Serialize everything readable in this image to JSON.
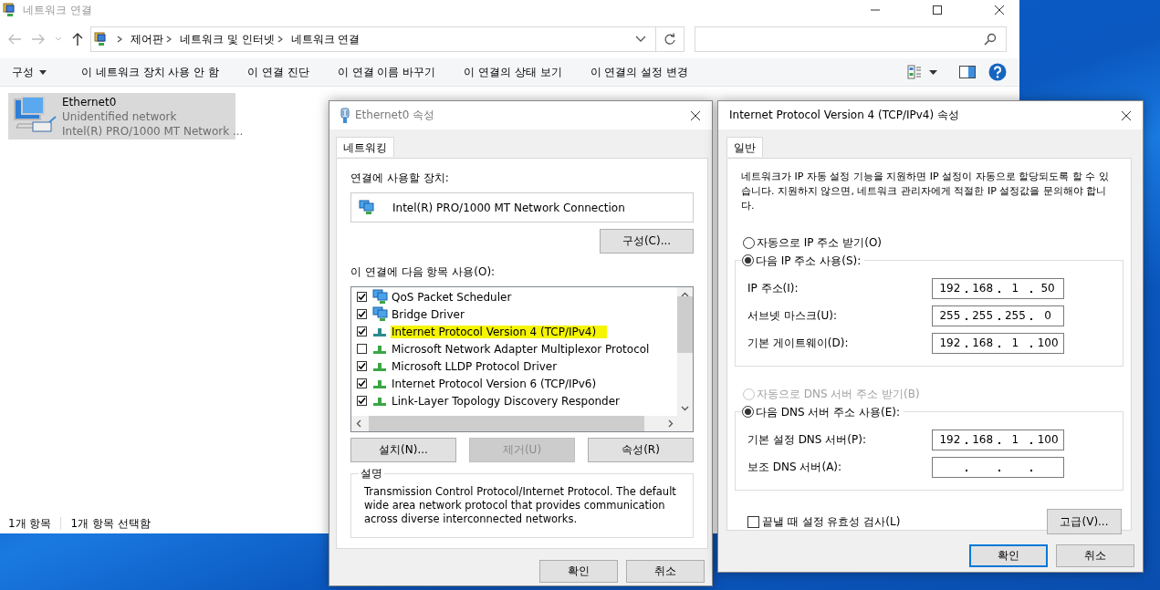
{
  "explorer": {
    "title": "네트워크 연결",
    "breadcrumb": [
      "제어판",
      "네트워크 및 인터넷",
      "네트워크 연결"
    ],
    "commands": [
      {
        "label": "구성",
        "kind": "menu"
      },
      {
        "label": "이 네트워크 장치 사용 안 함",
        "kind": "command"
      },
      {
        "label": "이 연결 진단",
        "kind": "command"
      },
      {
        "label": "이 연결 이름 바꾸기",
        "kind": "command"
      },
      {
        "label": "이 연결의 상태 보기",
        "kind": "command"
      },
      {
        "label": "이 연결의 설정 변경",
        "kind": "command"
      }
    ],
    "items": [
      {
        "name": "Ethernet0",
        "status": "Unidentified network",
        "device": "Intel(R) PRO/1000 MT Network ...",
        "selected": true
      }
    ],
    "status_bar": [
      "1개 항목",
      "1개 항목 선택함"
    ]
  },
  "adapter_dialog": {
    "title": "Ethernet0 속성",
    "tabs": [
      {
        "label": "네트워킹",
        "selected": true
      }
    ],
    "device_label": "연결에 사용할 장치:",
    "device_name": "Intel(R) PRO/1000 MT Network Connection",
    "configure_button": "구성(C)...",
    "items_label": "이 연결에 다음 항목 사용(O):",
    "components": [
      {
        "label": "QoS Packet Scheduler",
        "checked": true,
        "highlighted": false,
        "kind": "service"
      },
      {
        "label": "Bridge Driver",
        "checked": true,
        "highlighted": false,
        "kind": "service"
      },
      {
        "label": "Internet Protocol Version 4 (TCP/IPv4)",
        "checked": true,
        "highlighted": true,
        "kind": "protocol"
      },
      {
        "label": "Microsoft Network Adapter Multiplexor Protocol",
        "checked": false,
        "highlighted": false,
        "kind": "protocol"
      },
      {
        "label": "Microsoft LLDP Protocol Driver",
        "checked": true,
        "highlighted": false,
        "kind": "protocol"
      },
      {
        "label": "Internet Protocol Version 6 (TCP/IPv6)",
        "checked": true,
        "highlighted": false,
        "kind": "protocol"
      },
      {
        "label": "Link-Layer Topology Discovery Responder",
        "checked": true,
        "highlighted": false,
        "kind": "protocol"
      }
    ],
    "buttons": [
      {
        "label": "설치(N)...",
        "disabled": false
      },
      {
        "label": "제거(U)",
        "disabled": true
      },
      {
        "label": "속성(R)",
        "disabled": false
      }
    ],
    "description": {
      "legend": "설명",
      "text": "Transmission Control Protocol/Internet Protocol. The default wide area network protocol that provides communication across diverse interconnected networks."
    },
    "footer_buttons": [
      {
        "label": "확인",
        "default": false
      },
      {
        "label": "취소",
        "default": false
      }
    ]
  },
  "ipv4_dialog": {
    "title": "Internet Protocol Version 4 (TCP/IPv4) 속성",
    "tabs": [
      {
        "label": "일반",
        "selected": true
      }
    ],
    "intro": "네트워크가 IP 자동 설정 기능을 지원하면 IP 설정이 자동으로 할당되도록 할 수 있습니다. 지원하지 않으면, 네트워크 관리자에게 적절한 IP 설정값을 문의해야 합니다.",
    "ip_options": [
      {
        "label": "자동으로 IP 주소 받기(O)",
        "selected": false,
        "disabled": false
      },
      {
        "label": "다음 IP 주소 사용(S):",
        "selected": true,
        "disabled": false
      }
    ],
    "ip_fields": [
      {
        "label": "IP 주소(I):",
        "octets": [
          "192",
          "168",
          "1",
          "50"
        ]
      },
      {
        "label": "서브넷 마스크(U):",
        "octets": [
          "255",
          "255",
          "255",
          "0"
        ]
      },
      {
        "label": "기본 게이트웨이(D):",
        "octets": [
          "192",
          "168",
          "1",
          "100"
        ]
      }
    ],
    "dns_options": [
      {
        "label": "자동으로 DNS 서버 주소 받기(B)",
        "selected": false,
        "disabled": true
      },
      {
        "label": "다음 DNS 서버 주소 사용(E):",
        "selected": true,
        "disabled": false
      }
    ],
    "dns_fields": [
      {
        "label": "기본 설정 DNS 서버(P):",
        "octets": [
          "192",
          "168",
          "1",
          "100"
        ]
      },
      {
        "label": "보조 DNS 서버(A):"
      }
    ],
    "validate": {
      "label": "끝낼 때 설정 유효성 검사(L)",
      "checked": false
    },
    "advanced_button": "고급(V)...",
    "footer_buttons": [
      {
        "label": "확인",
        "default": true
      },
      {
        "label": "취소",
        "default": false
      }
    ]
  }
}
